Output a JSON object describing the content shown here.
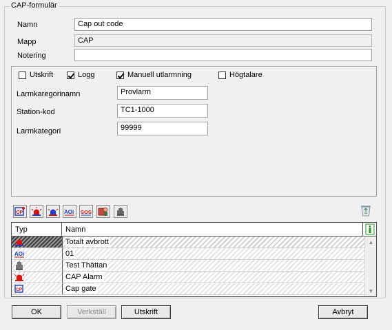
{
  "form": {
    "title": "CAP-formulär"
  },
  "fields": {
    "namn": {
      "label": "Namn",
      "value": "Cap out code"
    },
    "mapp": {
      "label": "Mapp",
      "value": "CAP"
    },
    "notering": {
      "label": "Notering",
      "value": ""
    }
  },
  "options": {
    "utskrift": {
      "label": "Utskrift",
      "checked": false
    },
    "logg": {
      "label": "Logg",
      "checked": true
    },
    "manuell": {
      "label": "Manuell utlarmning",
      "checked": true
    },
    "hogtalare": {
      "label": "Högtalare",
      "checked": false
    }
  },
  "details": {
    "larmkategorinamn": {
      "label": "Larmkaregorinamn",
      "value": "Provlarm"
    },
    "stationkod": {
      "label": "Station-kod",
      "value": "TC1-1000"
    },
    "larmkategori": {
      "label": "Larmkategori",
      "value": "99999"
    }
  },
  "toolbar": {
    "icons": [
      "cap-alarm-icon",
      "siren-red-icon",
      "siren-blue-icon",
      "aoi-icon",
      "sos-icon",
      "person-alarm-icon",
      "hand-icon"
    ],
    "sos_label": "SOS",
    "aoi_label": "AOi",
    "recycle_icon": "recycle-bin-icon"
  },
  "table": {
    "columns": [
      "Typ",
      "Namn"
    ],
    "rows": [
      {
        "icon": "siren-icon",
        "name": "Totalt avbrott",
        "selected": true
      },
      {
        "icon": "aoi-icon",
        "name": "01",
        "selected": false
      },
      {
        "icon": "hand-icon",
        "name": "Test Thättan",
        "selected": false
      },
      {
        "icon": "siren-red-icon",
        "name": "CAP Alarm",
        "selected": false
      },
      {
        "icon": "cap-icon",
        "name": "Cap gate",
        "selected": false
      }
    ]
  },
  "buttons": {
    "ok": "OK",
    "verkstall": "Verkställ",
    "utskrift": "Utskrift",
    "avbryt": "Avbryt"
  },
  "colors": {
    "icon_red": "#e01010",
    "icon_blue": "#1a3fcf",
    "info_green": "#1a9a1a"
  }
}
